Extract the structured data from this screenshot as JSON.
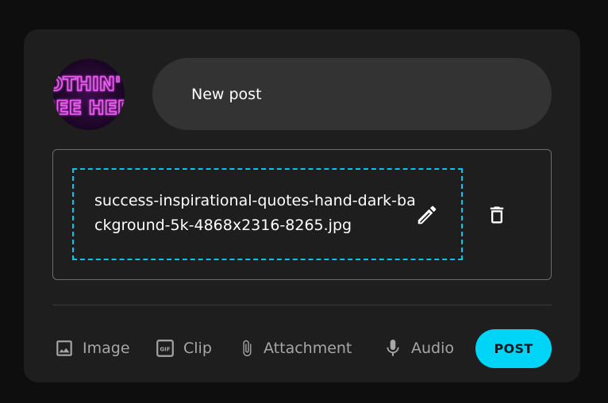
{
  "composer": {
    "avatar_text": "NOTHIN' TO SEE HERE",
    "post_placeholder": "New post"
  },
  "attachment": {
    "file_name": "success-inspirational-quotes-hand-dark-background-5k-4868x2316-8265.jpg"
  },
  "toolbar": {
    "image_label": "Image",
    "clip_label": "Clip",
    "clip_icon_text": "GIF",
    "attachment_label": "Attachment",
    "audio_label": "Audio",
    "post_label": "POST"
  },
  "colors": {
    "accent": "#00d4f7",
    "card_bg": "#1e1e1e",
    "page_bg": "#0e0e0e",
    "neon_text": "#e84cf0"
  }
}
